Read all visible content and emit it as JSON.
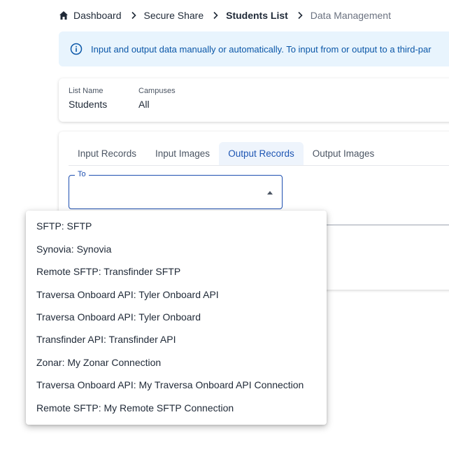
{
  "breadcrumb": {
    "items": [
      "Dashboard",
      "Secure Share",
      "Students List",
      "Data Management"
    ]
  },
  "info_banner": {
    "text": "Input and output data manually or automatically. To input from or output to a third-par"
  },
  "list_info": {
    "list_name_label": "List Name",
    "list_name_value": "Students",
    "campuses_label": "Campuses",
    "campuses_value": "All"
  },
  "tabs": {
    "items": [
      "Input Records",
      "Input Images",
      "Output Records",
      "Output Images"
    ],
    "active": "Output Records"
  },
  "to_field": {
    "label": "To",
    "value": ""
  },
  "dropdown": {
    "options": [
      "SFTP: SFTP",
      "Synovia: Synovia",
      "Remote SFTP: Transfinder SFTP",
      "Traversa Onboard API: Tyler Onboard API",
      "Traversa Onboard API: Tyler Onboard",
      "Transfinder API: Transfinder API",
      "Zonar: My Zonar Connection",
      "Traversa Onboard API: My Traversa Onboard API Connection",
      "Remote SFTP: My Remote SFTP Connection"
    ]
  },
  "colors": {
    "accent": "#1d4fb0",
    "banner_bg": "#e8f4fd",
    "banner_text": "#0b57a8",
    "active_tab_bg": "#eef4fc"
  },
  "icons": [
    "home-icon",
    "chevron-right-icon",
    "info-icon",
    "caret-up-icon"
  ]
}
